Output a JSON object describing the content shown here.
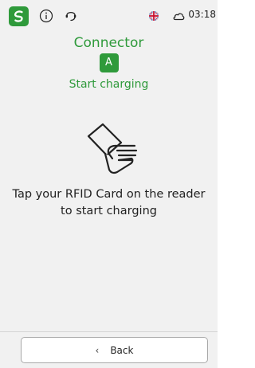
{
  "status_bar": {
    "time": "03:18",
    "icons": [
      "app-logo-icon",
      "info-icon",
      "support-icon",
      "uk-flag-icon",
      "cloud-connection-icon"
    ]
  },
  "header": {
    "title": "Connector",
    "connector_id": "A",
    "status": "Start charging"
  },
  "main": {
    "illustration": "rfid-card-tap-icon",
    "instruction_line1": "Tap your RFID Card on the reader",
    "instruction_line2": "to start charging"
  },
  "footer": {
    "back_label": "Back"
  },
  "colors": {
    "accent": "#2f9a3b",
    "background": "#f1f1f1",
    "text": "#222222"
  }
}
